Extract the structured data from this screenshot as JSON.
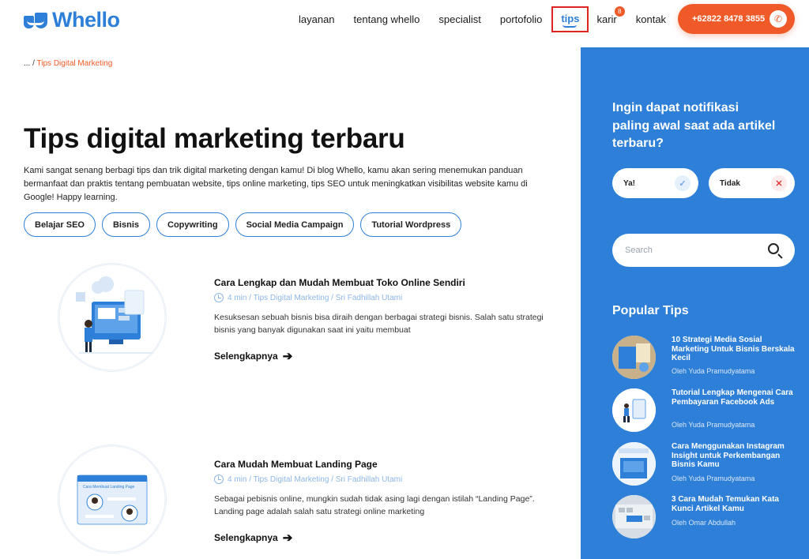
{
  "brand": {
    "name": "Whello",
    "color": "#2d7fd8",
    "accent": "#f05a28"
  },
  "nav": {
    "items": [
      {
        "label": "layanan"
      },
      {
        "label": "tentang whello"
      },
      {
        "label": "specialist"
      },
      {
        "label": "portofolio"
      },
      {
        "label": "tips"
      },
      {
        "label": "karir",
        "badge": "8"
      },
      {
        "label": "kontak"
      }
    ],
    "phone": "+62822 8478 3855"
  },
  "breadcrumb": {
    "ellipsis": "...",
    "separator": "/",
    "current": "Tips Digital Marketing"
  },
  "main": {
    "title": "Tips digital marketing terbaru",
    "intro": "Kami sangat senang berbagi tips dan trik digital marketing dengan kamu! Di blog Whello, kamu akan sering menemukan panduan bermanfaat dan praktis tentang pembuatan website, tips online marketing, tips SEO untuk meningkatkan visibilitas website kamu di Google! Happy learning.",
    "tags": [
      "Belajar SEO",
      "Bisnis",
      "Copywriting",
      "Social Media Campaign",
      "Tutorial Wordpress"
    ],
    "articles": [
      {
        "title": "Cara Lengkap dan Mudah Membuat Toko Online Sendiri",
        "meta": "4 min / Tips Digital Marketing / Sri Fadhillah Utami",
        "excerpt": "Kesuksesan sebuah bisnis bisa diraih dengan berbagai strategi bisnis. Salah satu strategi bisnis yang banyak digunakan saat ini yaitu membuat",
        "readmore": "Selengkapnya"
      },
      {
        "title": "Cara Mudah Membuat Landing Page",
        "meta": "4 min / Tips Digital Marketing / Sri Fadhillah Utami",
        "excerpt": "Sebagai pebisnis online, mungkin sudah tidak asing lagi dengan istilah “Landing Page”. Landing page adalah salah satu strategi online marketing",
        "readmore": "Selengkapnya",
        "thumb_caption": "Cara Membuat Landing Page"
      }
    ]
  },
  "sidebar": {
    "question": "Ingin dapat notifikasi paling awal saat ada artikel terbaru?",
    "yes": "Ya!",
    "no": "Tidak",
    "search_placeholder": "Search",
    "popular_title": "Popular Tips",
    "popular": [
      {
        "title": "10 Strategi Media Sosial Marketing Untuk Bisnis Berskala Kecil",
        "author": "Oleh Yuda Pramudyatama"
      },
      {
        "title": "Tutorial Lengkap Mengenai Cara Pembayaran Facebook Ads",
        "author": "Oleh Yuda Pramudyatama"
      },
      {
        "title": "Cara Menggunakan Instagram Insight untuk Perkembangan Bisnis Kamu",
        "author": "Oleh Yuda Pramudyatama"
      },
      {
        "title": "3 Cara Mudah Temukan Kata Kunci Artikel Kamu",
        "author": "Oleh Omar Abdullah"
      }
    ]
  }
}
